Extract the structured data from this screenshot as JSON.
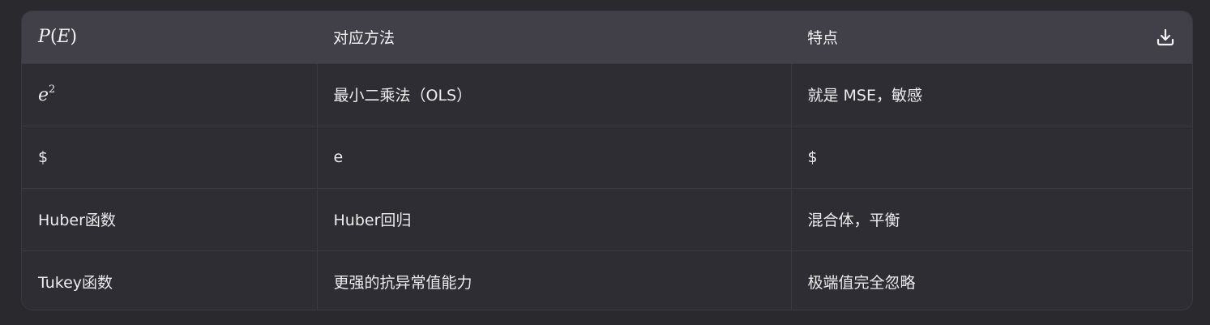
{
  "table": {
    "headers": [
      {
        "var": "P",
        "paren_open": "(",
        "arg": "E",
        "paren_close": ")"
      },
      {
        "label": "对应方法"
      },
      {
        "label": "特点"
      }
    ],
    "rows": [
      {
        "c1_base": "e",
        "c1_sup": "2",
        "c2": "最小二乘法（OLS）",
        "c3": "就是 MSE，敏感"
      },
      {
        "c1": "$",
        "c2": "e",
        "c3": "$"
      },
      {
        "c1": "Huber函数",
        "c2": "Huber回归",
        "c3": "混合体，平衡"
      },
      {
        "c1": "Tukey函数",
        "c2": "更强的抗异常值能力",
        "c3": "极端值完全忽略"
      }
    ],
    "download_icon": "download-icon"
  }
}
